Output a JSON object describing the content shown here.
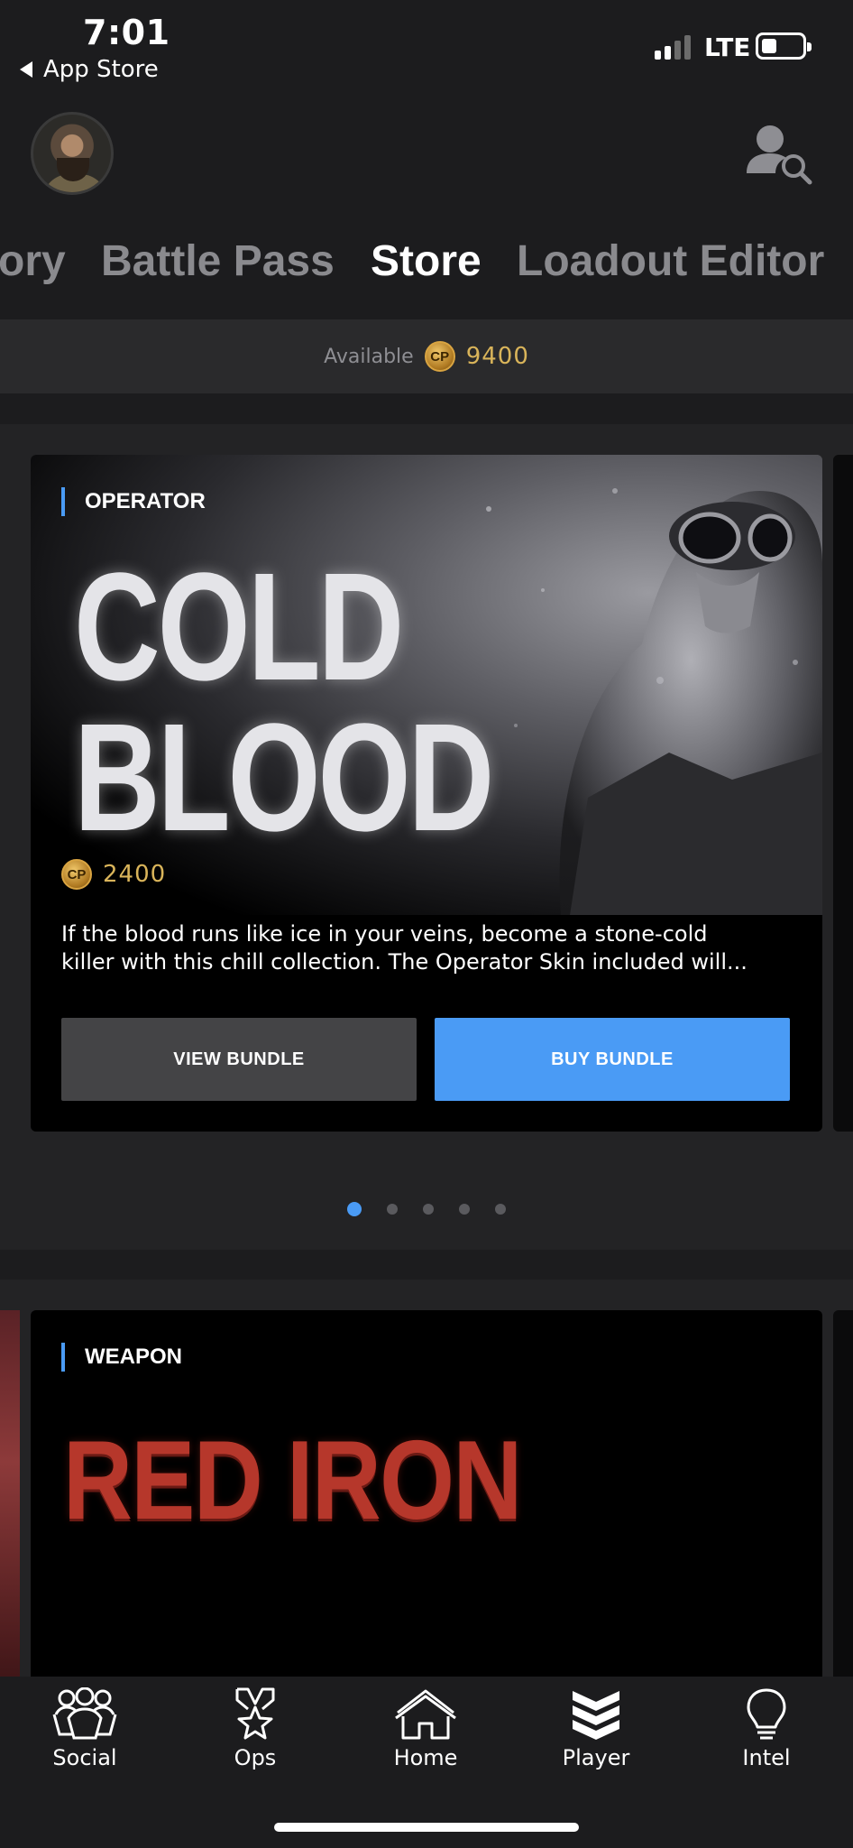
{
  "status_bar": {
    "time": "7:01",
    "back_label": "App Store",
    "network": "LTE"
  },
  "header": {
    "avatar_icon": "operator-avatar",
    "player_search_icon": "player-search-icon"
  },
  "top_tabs": [
    {
      "label": "ory",
      "active": false
    },
    {
      "label": "Battle Pass",
      "active": false
    },
    {
      "label": "Store",
      "active": true
    },
    {
      "label": "Loadout Editor",
      "active": false
    }
  ],
  "available": {
    "label": "Available",
    "currency_icon": "cp-coin",
    "currency_code": "CP",
    "amount": "9400"
  },
  "featured_bundle": {
    "tag": "OPERATOR",
    "title_lines": [
      "COLD",
      "BLOOD"
    ],
    "price": "2400",
    "description_lines": [
      "If the blood runs like ice in your veins, become a stone-cold",
      "killer with this chill collection. The Operator Skin included will..."
    ],
    "view_label": "VIEW BUNDLE",
    "buy_label": "BUY BUNDLE"
  },
  "carousel": {
    "page_count": 5,
    "active_index": 0
  },
  "second_bundle": {
    "tag": "WEAPON",
    "title": "RED IRON"
  },
  "bottom_nav": [
    {
      "label": "Social",
      "icon": "social-icon"
    },
    {
      "label": "Ops",
      "icon": "ops-medal-icon"
    },
    {
      "label": "Home",
      "icon": "home-icon"
    },
    {
      "label": "Player",
      "icon": "player-chevrons-icon"
    },
    {
      "label": "Intel",
      "icon": "intel-lightbulb-icon"
    }
  ],
  "colors": {
    "accent_blue": "#4a9bf5",
    "gold": "#d9b45a",
    "background": "#1c1c1e",
    "red_iron": "#b6372b"
  }
}
